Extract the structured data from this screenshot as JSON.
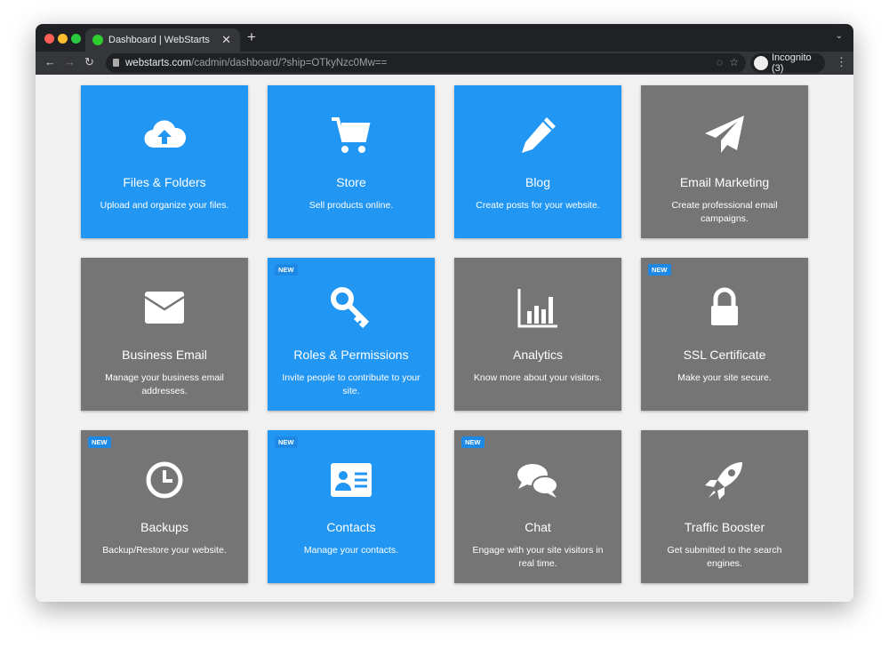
{
  "browser": {
    "tab_title": "Dashboard | WebStarts",
    "url_domain": "webstarts.com",
    "url_path": "/cadmin/dashboard/?ship=OTkyNzc0Mw==",
    "profile": "Incognito (3)"
  },
  "colors": {
    "blue": "#2196f3",
    "gray": "#757575",
    "badge_blue": "#1e88e5"
  },
  "cards": [
    {
      "title": "Files & Folders",
      "desc": "Upload and organize your files.",
      "icon": "cloud-upload-icon",
      "color": "blue",
      "new": false
    },
    {
      "title": "Store",
      "desc": "Sell products online.",
      "icon": "shopping-cart-icon",
      "color": "blue",
      "new": false
    },
    {
      "title": "Blog",
      "desc": "Create posts for your website.",
      "icon": "pencil-icon",
      "color": "blue",
      "new": false
    },
    {
      "title": "Email Marketing",
      "desc": "Create professional email campaigns.",
      "icon": "paper-plane-icon",
      "color": "gray",
      "new": false
    },
    {
      "title": "Business Email",
      "desc": "Manage your business email addresses.",
      "icon": "envelope-icon",
      "color": "gray",
      "new": false
    },
    {
      "title": "Roles & Permissions",
      "desc": "Invite people to contribute to your site.",
      "icon": "key-icon",
      "color": "blue",
      "new": true
    },
    {
      "title": "Analytics",
      "desc": "Know more about your visitors.",
      "icon": "bar-chart-icon",
      "color": "gray",
      "new": false
    },
    {
      "title": "SSL Certificate",
      "desc": "Make your site secure.",
      "icon": "lock-icon",
      "color": "gray",
      "new": true
    },
    {
      "title": "Backups",
      "desc": "Backup/Restore your website.",
      "icon": "clock-icon",
      "color": "gray",
      "new": true
    },
    {
      "title": "Contacts",
      "desc": "Manage your contacts.",
      "icon": "contact-card-icon",
      "color": "blue",
      "new": true
    },
    {
      "title": "Chat",
      "desc": "Engage with your site visitors in real time.",
      "icon": "chat-bubbles-icon",
      "color": "gray",
      "new": true
    },
    {
      "title": "Traffic Booster",
      "desc": "Get submitted to the search engines.",
      "icon": "rocket-icon",
      "color": "gray",
      "new": false
    }
  ],
  "badge_label": "NEW"
}
